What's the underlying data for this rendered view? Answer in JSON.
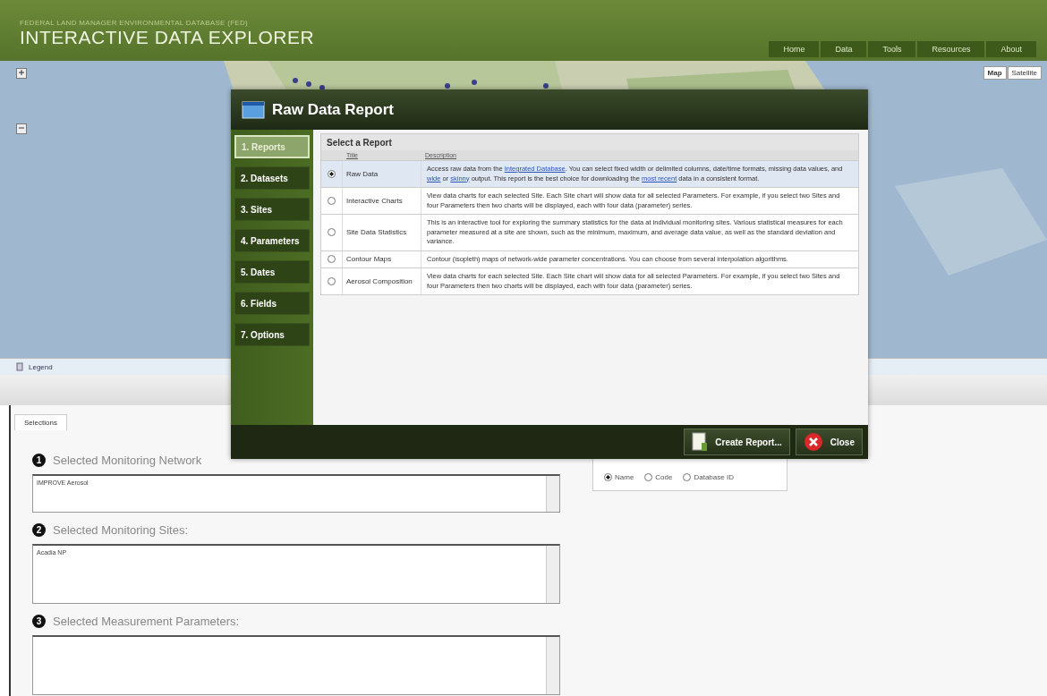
{
  "header": {
    "subtitle": "FEDERAL LAND MANAGER ENVIRONMENTAL DATABASE (FED)",
    "title": "INTERACTIVE DATA EXPLORER",
    "nav": [
      {
        "label": "Home",
        "selected": false
      },
      {
        "label": "Data",
        "selected": false
      },
      {
        "label": "Tools",
        "selected": false
      },
      {
        "label": "Resources",
        "selected": false
      },
      {
        "label": "About",
        "selected": false
      }
    ]
  },
  "map": {
    "types": [
      {
        "label": "Map",
        "selected": true
      },
      {
        "label": "Satellite",
        "selected": false
      }
    ],
    "legend": "Legend"
  },
  "dialog": {
    "title": "Raw Data Report",
    "steps": [
      {
        "label": "1. Reports",
        "selected": true
      },
      {
        "label": "2. Datasets",
        "selected": false
      },
      {
        "label": "3. Sites",
        "selected": false
      },
      {
        "label": "4. Parameters",
        "selected": false
      },
      {
        "label": "5. Dates",
        "selected": false
      },
      {
        "label": "6. Fields",
        "selected": false
      },
      {
        "label": "7. Options",
        "selected": false
      }
    ],
    "panel_title": "Select a Report",
    "columns": [
      "Title",
      "Description"
    ],
    "reports": [
      {
        "title": "Raw Data",
        "selected": true,
        "description": [
          {
            "text": "Access raw data from the ",
            "kind": "text"
          },
          {
            "text": "Integrated Database",
            "kind": "link"
          },
          {
            "text": ". You can select fixed width or delimited columns, date/time formats, missing data values, and ",
            "kind": "text"
          },
          {
            "text": "wide",
            "kind": "link"
          },
          {
            "text": " or ",
            "kind": "text"
          },
          {
            "text": "skinny",
            "kind": "link"
          },
          {
            "text": " output. This report is the best choice for downloading the ",
            "kind": "text"
          },
          {
            "text": "most recent",
            "kind": "link"
          },
          {
            "text": " data in a consistent format.",
            "kind": "text"
          }
        ]
      },
      {
        "title": "Interactive Charts",
        "selected": false,
        "description": [
          {
            "text": "View data charts for each selected Site. Each Site chart will show data for all selected Parameters. For example, if you select two Sites and four Parameters then two charts will be displayed, each with four data (parameter) series.",
            "kind": "text"
          }
        ]
      },
      {
        "title": "Site Data Statistics",
        "selected": false,
        "description": [
          {
            "text": "This is an interactive tool for exploring the summary statistics for the data at individual monitoring sites. Various statistical measures for each parameter measured at a site are shown, such as the minimum, maximum, and average data value, as well as the standard deviation and variance.",
            "kind": "text"
          }
        ]
      },
      {
        "title": "Contour Maps",
        "selected": false,
        "description": [
          {
            "text": "Contour (isopleth) maps of network-wide parameter concentrations. You can choose from several interpolation algorithms.",
            "kind": "text"
          }
        ]
      },
      {
        "title": "Aerosol Composition",
        "selected": false,
        "description": [
          {
            "text": "View data charts for each selected Site. Each Site chart will show data for all selected Parameters. For example, if you select two Sites and four Parameters then two charts will be displayed, each with four data (parameter) series.",
            "kind": "text"
          }
        ]
      }
    ],
    "buttons": [
      {
        "kind": "create",
        "label": "Create Report..."
      },
      {
        "kind": "close",
        "label": "Close"
      }
    ]
  },
  "selections": {
    "tab": "Selections",
    "sections": [
      {
        "number": "1",
        "label": "Selected Monitoring Network",
        "value": "IMPROVE Aerosol"
      },
      {
        "number": "2",
        "label": "Selected Monitoring Sites:",
        "value": "Acadia NP"
      },
      {
        "number": "3",
        "label": "Selected Measurement Parameters:"
      }
    ],
    "display": [
      {
        "label": "Name",
        "selected": true
      },
      {
        "label": "Code",
        "selected": false
      },
      {
        "label": "Database ID",
        "selected": false
      }
    ]
  }
}
